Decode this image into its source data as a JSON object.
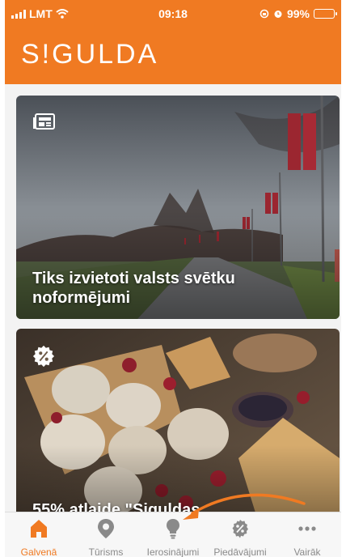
{
  "status_bar": {
    "carrier": "LMT",
    "time": "09:18",
    "battery": "99%"
  },
  "header": {
    "logo": "S!GULDA"
  },
  "feed": [
    {
      "title": "Tiks izvietoti valsts svētku noformējumi",
      "icon": "news-icon"
    },
    {
      "title": "55% atlaide \"Siguldas",
      "icon": "discount-icon"
    }
  ],
  "tabs": [
    {
      "label": "Galvenā",
      "icon": "home-icon",
      "active": true
    },
    {
      "label": "Tūrisms",
      "icon": "location-pin-icon",
      "active": false
    },
    {
      "label": "Ierosinājumi",
      "icon": "lightbulb-icon",
      "active": false
    },
    {
      "label": "Piedāvājumi",
      "icon": "discount-badge-icon",
      "active": false
    },
    {
      "label": "Vairāk",
      "icon": "more-dots-icon",
      "active": false
    }
  ],
  "colors": {
    "brand": "#f07a22",
    "inactive": "#8a8a8a",
    "annotation_arrow": "#f07a22"
  }
}
